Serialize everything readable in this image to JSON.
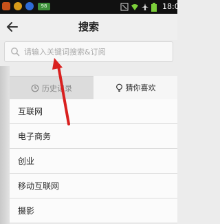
{
  "status_bar": {
    "badge": "98",
    "time": "18:0"
  },
  "header": {
    "title": "搜索"
  },
  "search": {
    "placeholder": "请输入关键词搜索&订阅"
  },
  "tabs": [
    {
      "label": "历史记录",
      "icon": "clock-icon"
    },
    {
      "label": "猜你喜欢",
      "icon": "lightbulb-icon"
    }
  ],
  "suggestions": [
    "互联网",
    "电子商务",
    "创业",
    "移动互联网",
    "摄影"
  ],
  "colors": {
    "arrow": "#d9201f",
    "status_bar": "#111111"
  }
}
